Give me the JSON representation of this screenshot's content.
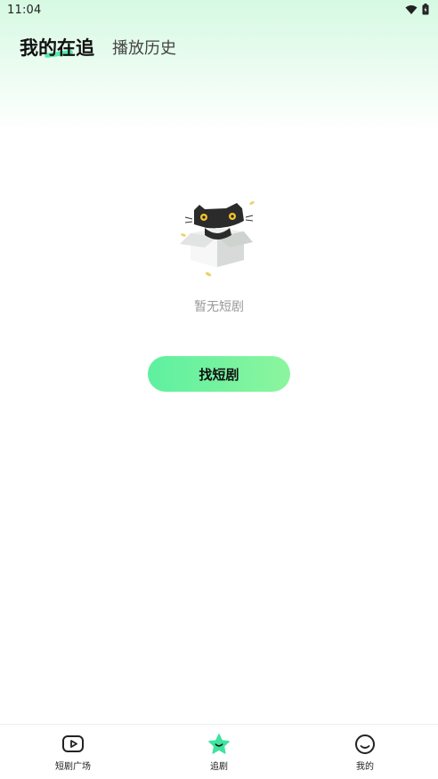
{
  "status_bar": {
    "time": "11:04",
    "icons": [
      "wifi-icon",
      "battery-icon"
    ]
  },
  "tabs": [
    {
      "label": "我的在追",
      "active": true
    },
    {
      "label": "播放历史",
      "active": false
    }
  ],
  "empty_state": {
    "illustration": "cat-in-box-icon",
    "message": "暂无短剧",
    "button_label": "找短剧"
  },
  "bottom_nav": [
    {
      "label": "短剧广场",
      "icon": "video-play-icon",
      "active": false
    },
    {
      "label": "追剧",
      "icon": "star-face-icon",
      "active": true
    },
    {
      "label": "我的",
      "icon": "smile-face-icon",
      "active": false
    }
  ],
  "colors": {
    "accent": "#5ef0a0",
    "accent_light": "#8cf59e",
    "header_gradient_top": "#d6f9e2",
    "active_star": "#3fe3a0"
  }
}
